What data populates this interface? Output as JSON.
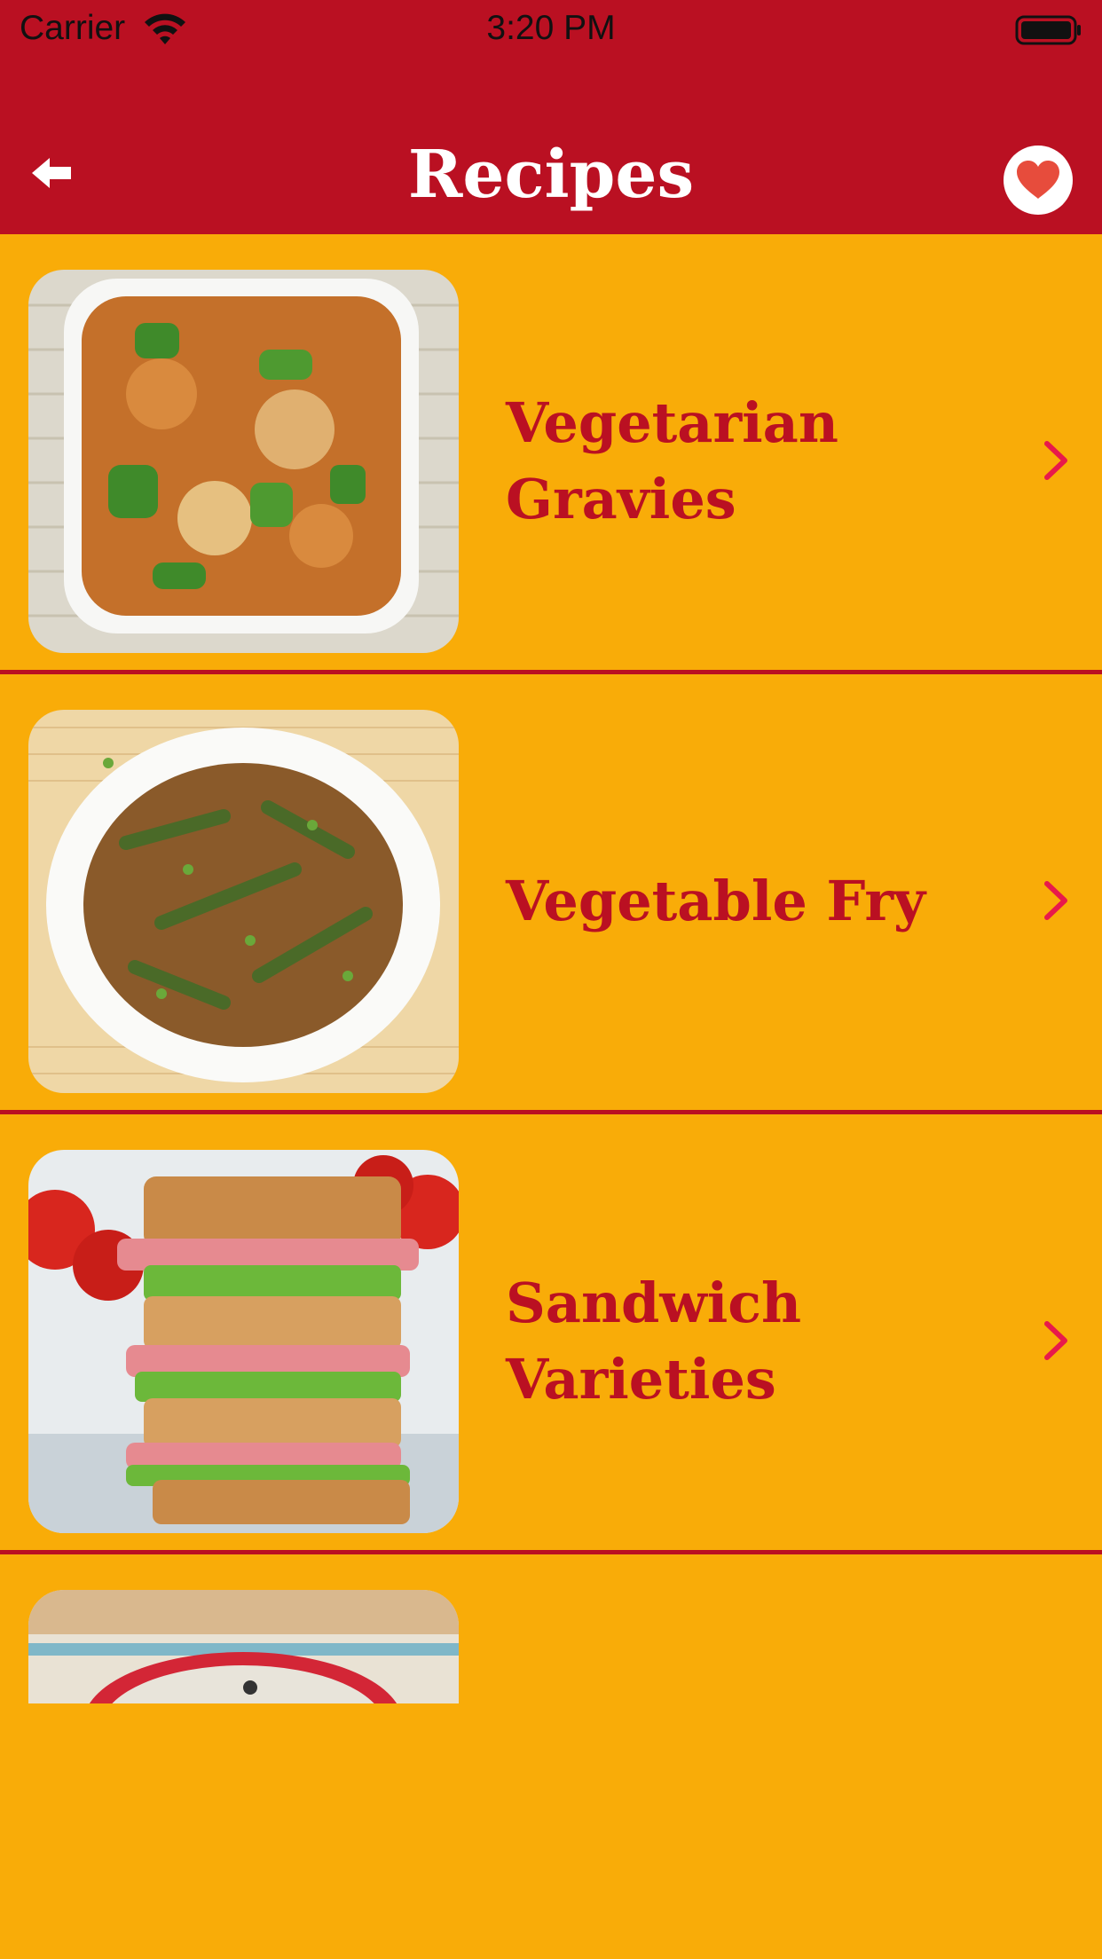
{
  "status_bar": {
    "carrier": "Carrier",
    "time": "3:20 PM",
    "wifi_icon": "wifi-icon",
    "battery_icon": "battery-full-icon"
  },
  "nav": {
    "title": "Recipes",
    "back_icon": "back-arrow-icon",
    "favorites_icon": "heart-icon"
  },
  "colors": {
    "header_bg": "#BA1022",
    "list_bg": "#F9AC08",
    "label_text": "#BA1022",
    "chevron": "#E8194B",
    "heart": "#E74C3C"
  },
  "recipes": [
    {
      "label": "Vegetarian Gravies",
      "image": "vegetarian-gravies-photo"
    },
    {
      "label": "Vegetable Fry",
      "image": "vegetable-fry-photo"
    },
    {
      "label": "Sandwich Varieties",
      "image": "sandwich-varieties-photo"
    },
    {
      "label": "",
      "image": "partial-recipe-photo"
    }
  ]
}
